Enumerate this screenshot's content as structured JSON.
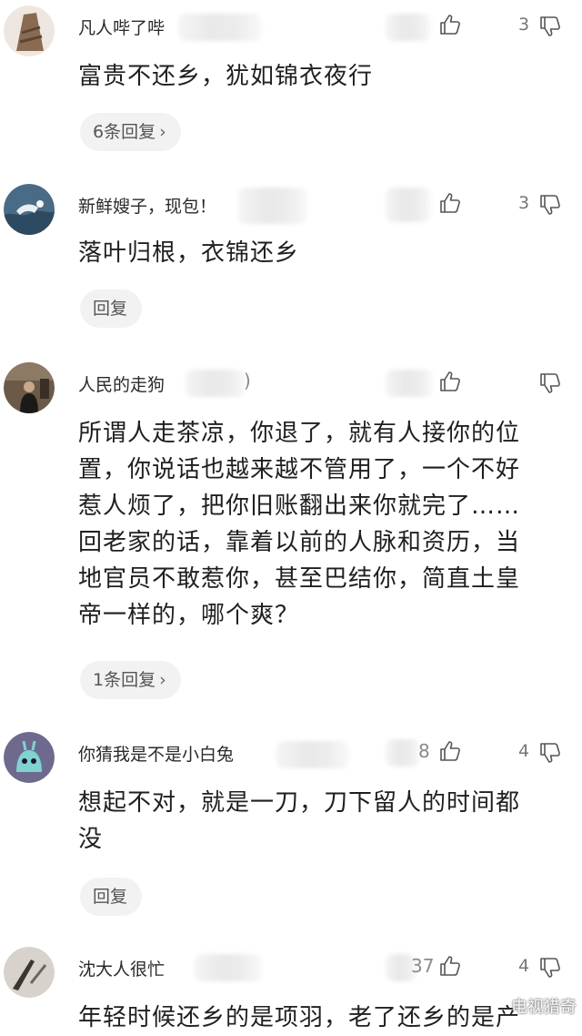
{
  "comments": [
    {
      "username": "凡人哔了哔",
      "like_trail": "",
      "like_count": "",
      "dislike_count": "3",
      "text": "富贵不还乡，犹如锦衣夜行",
      "reply_label": "6条回复",
      "reply_chevron": "›"
    },
    {
      "username": "新鲜嫂子，现包！",
      "like_trail": "",
      "like_count": "",
      "dislike_count": "3",
      "text": "落叶归根，衣锦还乡",
      "reply_label": "回复",
      "reply_chevron": ""
    },
    {
      "username": "人民的走狗",
      "username_trail": ")",
      "like_trail": "",
      "like_count": "",
      "dislike_count": "",
      "text_lines": [
        "所谓人走茶凉，你退了，就有人接你的位",
        "置，你说话也越来越不管用了，一个不好",
        "惹人烦了，把你旧账翻出来你就完了……",
        "回老家的话，靠着以前的人脉和资历，当",
        "地官员不敢惹你，甚至巴结你，简直土皇",
        "帝一样的，哪个爽？"
      ],
      "reply_label": "1条回复",
      "reply_chevron": "›"
    },
    {
      "username": "你猜我是不是小白兔",
      "like_trail": "8",
      "like_count": "",
      "dislike_count": "4",
      "text_lines": [
        "想起不对，就是一刀，刀下留人的时间都",
        "没"
      ],
      "reply_label": "回复",
      "reply_chevron": ""
    },
    {
      "username": "沈大人很忙",
      "like_trail": "37",
      "like_count": "",
      "dislike_count": "4",
      "text": "年轻时候还乡的是项羽，老了还乡的是产"
    }
  ],
  "watermark": "电视猎奇"
}
